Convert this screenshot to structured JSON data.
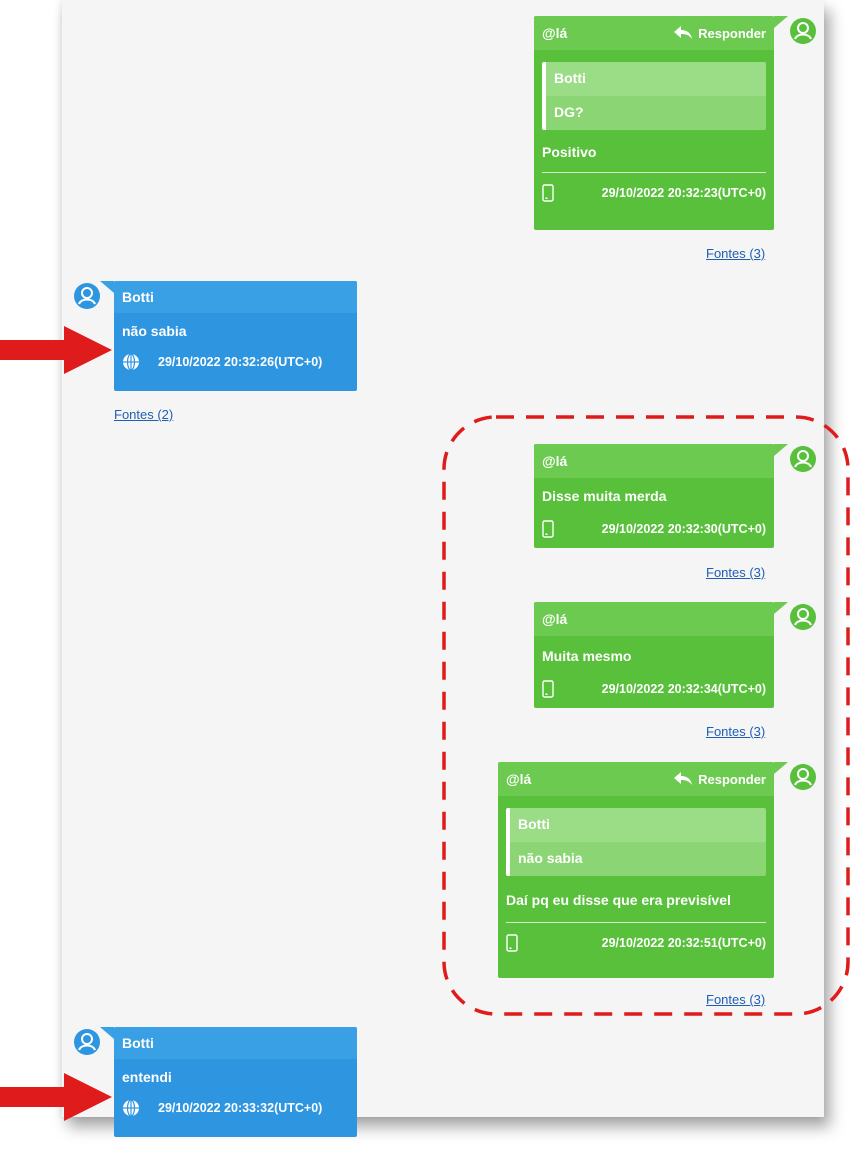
{
  "colors": {
    "green": "#59c03c",
    "blue": "#2e95e0",
    "link": "#1f5fb3",
    "annotation": "#e01b1b"
  },
  "messages": [
    {
      "sender": "@lá",
      "reply_label": "Responder",
      "quote_sender": "Botti",
      "quote_text": "DG?",
      "text": "Positivo",
      "device_icon": "phone-icon",
      "timestamp": "29/10/2022 20:32:23(UTC+0)",
      "sources": "Fontes (3)"
    },
    {
      "sender": "Botti",
      "text": "não sabia",
      "device_icon": "globe-icon",
      "timestamp": "29/10/2022 20:32:26(UTC+0)",
      "sources": "Fontes (2)"
    },
    {
      "sender": "@lá",
      "text": "Disse muita merda",
      "device_icon": "phone-icon",
      "timestamp": "29/10/2022 20:32:30(UTC+0)",
      "sources": "Fontes (3)"
    },
    {
      "sender": "@lá",
      "text": "Muita mesmo",
      "device_icon": "phone-icon",
      "timestamp": "29/10/2022 20:32:34(UTC+0)",
      "sources": "Fontes (3)"
    },
    {
      "sender": "@lá",
      "reply_label": "Responder",
      "quote_sender": "Botti",
      "quote_text": "não sabia",
      "text": "Daí pq eu disse que era previsível",
      "device_icon": "phone-icon",
      "timestamp": "29/10/2022 20:32:51(UTC+0)",
      "sources": "Fontes (3)"
    },
    {
      "sender": "Botti",
      "text": "entendi",
      "device_icon": "globe-icon",
      "timestamp": "29/10/2022 20:33:32(UTC+0)",
      "sources": ""
    }
  ]
}
